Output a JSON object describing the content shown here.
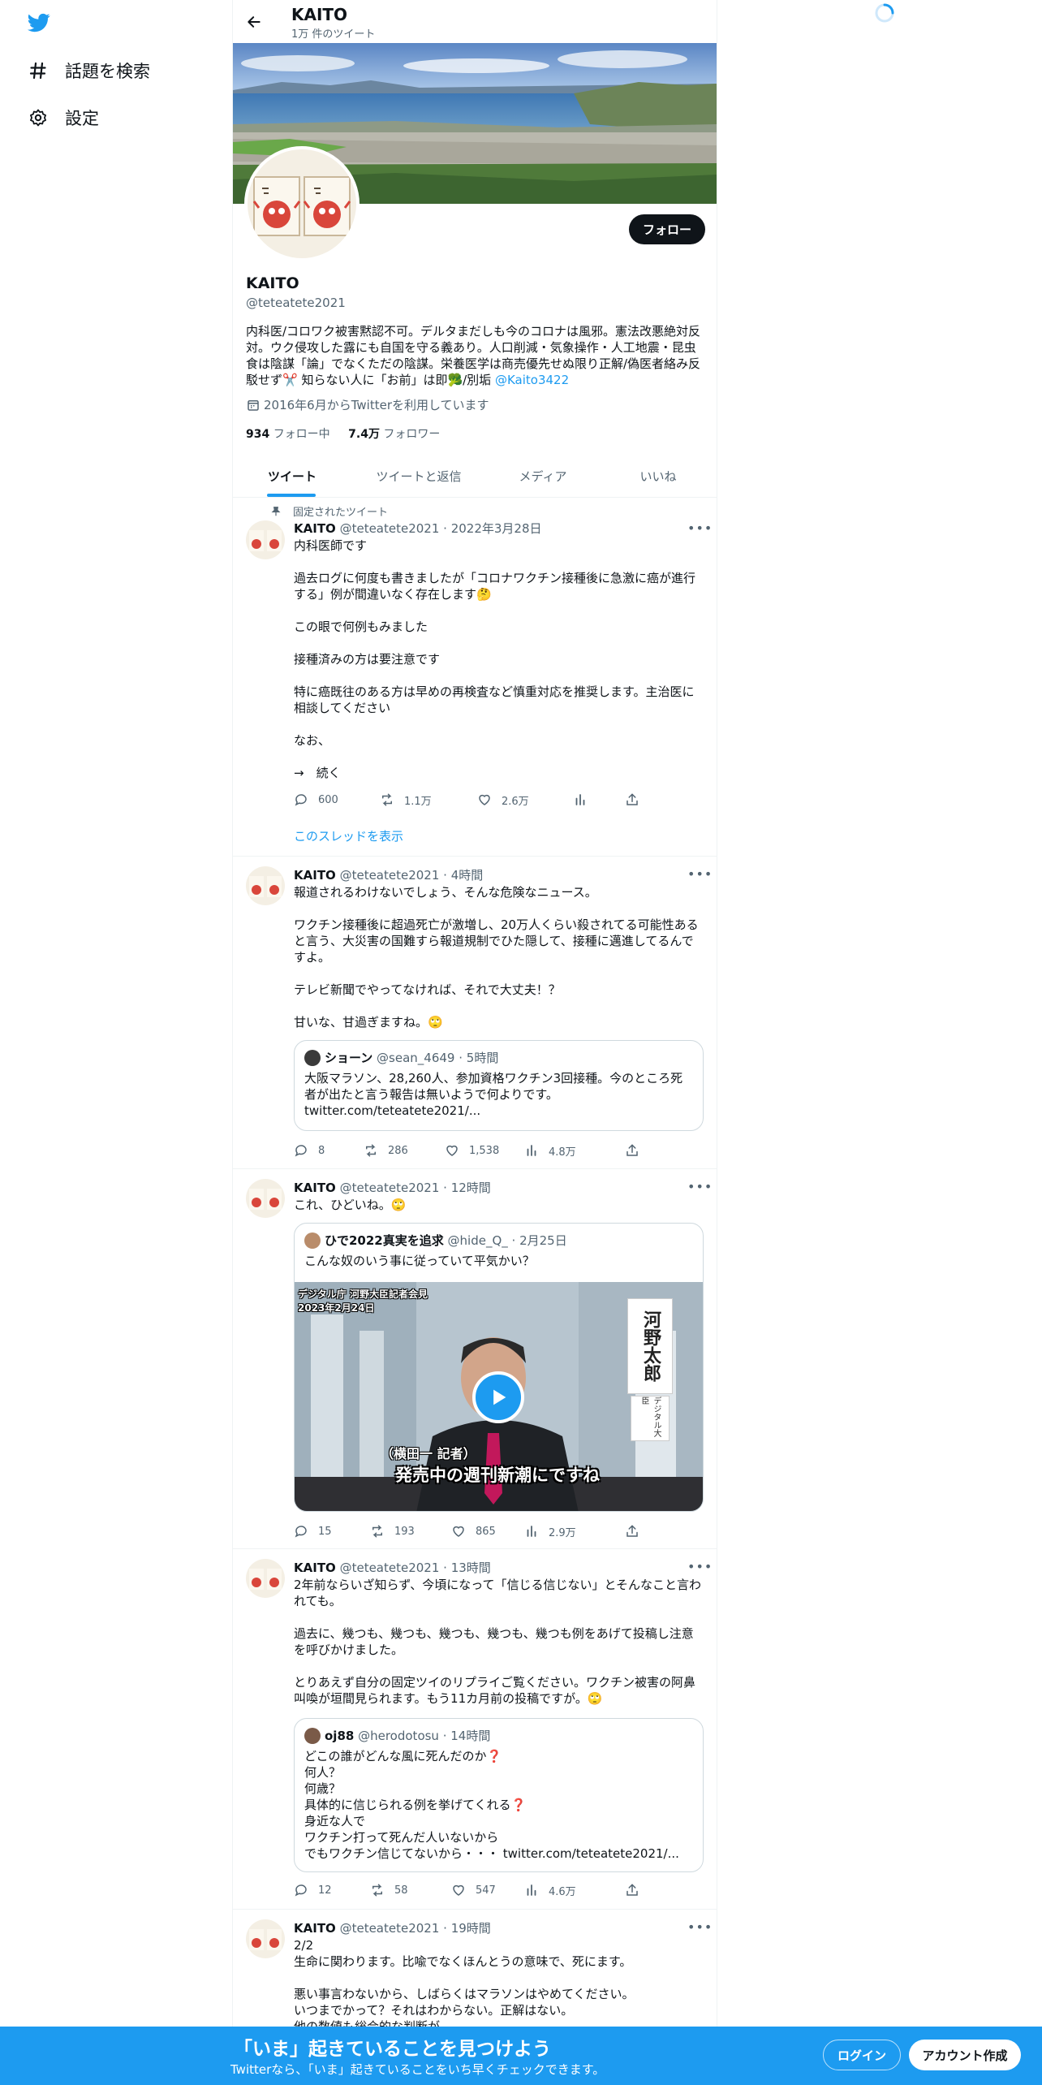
{
  "sidebar": {
    "items": [
      {
        "label": "話題を検索",
        "icon": "hashtag-icon"
      },
      {
        "label": "設定",
        "icon": "gear-icon"
      }
    ]
  },
  "header": {
    "name": "KAITO",
    "tweet_count": "1万 件のツイート"
  },
  "profile": {
    "name": "KAITO",
    "handle": "@teteatete2021",
    "follow_label": "フォロー",
    "bio": "内科医/コロワク被害黙認不可。デルタまだしも今のコロナは風邪。憲法改悪絶対反対。ウク侵攻した露にも自国を守る義あり。人口削減・気象操作・人工地震・昆虫食は陰謀「論」でなくただの陰謀。栄養医学は商売優先せぬ限り正解/偽医者絡み反駁せず✂️ 知らない人に「お前」は即🥦/別垢",
    "bio_link": "@Kaito3422",
    "joined": "2016年6月からTwitterを利用しています",
    "following_count": "934",
    "following_label": "フォロー中",
    "followers_count": "7.4万",
    "followers_label": "フォロワー"
  },
  "tabs": [
    {
      "label": "ツイート",
      "active": true
    },
    {
      "label": "ツイートと返信",
      "active": false
    },
    {
      "label": "メディア",
      "active": false
    },
    {
      "label": "いいね",
      "active": false
    }
  ],
  "tweets": [
    {
      "pinned_label": "固定されたツイート",
      "name": "KAITO",
      "handle": "@teteatete2021",
      "time": "2022年3月28日",
      "paragraphs": [
        "内科医師です",
        "過去ログに何度も書きましたが「コロナワクチン接種後に急激に癌が進行する」例が間違いなく存在します🤔",
        "この眼で何例もみました",
        "接種済みの方は要注意です",
        "特に癌既往のある方は早めの再検査など慎重対応を推奨します。主治医に相談してください",
        "なお、",
        "→　続く"
      ],
      "replies": "600",
      "retweets": "1.1万",
      "likes": "2.6万",
      "views": "",
      "thread_link": "このスレッドを表示"
    },
    {
      "name": "KAITO",
      "handle": "@teteatete2021",
      "time": "4時間",
      "paragraphs": [
        "報道されるわけないでしょう、そんな危険なニュース。",
        "ワクチン接種後に超過死亡が激増し、20万人くらい殺されてる可能性あると言う、大災害の国難すら報道規制でひた隠して、接種に邁進してるんですよ。",
        "テレビ新聞でやってなければ、それで大丈夫！？",
        "甘いな、甘過ぎますね。🙄"
      ],
      "quote": {
        "name": "ショーン",
        "handle": "@sean_4649",
        "time": "5時間",
        "text": "大阪マラソン、28,260人、参加資格ワクチン3回接種。今のところ死者が出たと言う報告は無いようで何よりです。",
        "link": "twitter.com/teteatete2021/..."
      },
      "replies": "8",
      "retweets": "286",
      "likes": "1,538",
      "views": "4.8万"
    },
    {
      "name": "KAITO",
      "handle": "@teteatete2021",
      "time": "12時間",
      "paragraphs": [
        "これ、ひどいね。🙄"
      ],
      "quote": {
        "name": "ひで2022真実を追求",
        "handle": "@hide_Q_",
        "time": "2月25日",
        "text": "こんな奴のいう事に従っていて平気かい？",
        "video_caption_top": "デジタル庁 河野大臣記者会見\n2023年2月24日",
        "video_caption_mid": "（横田一 記者）",
        "video_caption_main": "発売中の週刊新潮にですね",
        "video_side": "河野太郎",
        "video_side_small": "デジタル大臣"
      },
      "replies": "15",
      "retweets": "193",
      "likes": "865",
      "views": "2.9万"
    },
    {
      "name": "KAITO",
      "handle": "@teteatete2021",
      "time": "13時間",
      "paragraphs": [
        "2年前ならいざ知らず、今頃になって「信じる信じない」とそんなこと言われても。",
        "過去に、幾つも、幾つも、幾つも、幾つも、幾つも例をあげて投稿し注意を呼びかけました。",
        "とりあえず自分の固定ツイのリプライご覧ください。ワクチン被害の阿鼻叫喚が垣間見られます。もう11カ月前の投稿ですが。🙄"
      ],
      "quote": {
        "name": "oj88",
        "handle": "@herodotosu",
        "time": "14時間",
        "lines": [
          "どこの誰がどんな風に死んだのか❓",
          "何人？",
          "何歳？",
          "具体的に信じられる例を挙げてくれる❓",
          "身近な人で",
          "ワクチン打って死んだ人いないから",
          "でもワクチン信じてないから・・・ twitter.com/teteatete2021/..."
        ]
      },
      "replies": "12",
      "retweets": "58",
      "likes": "547",
      "views": "4.6万"
    },
    {
      "name": "KAITO",
      "handle": "@teteatete2021",
      "time": "19時間",
      "lines": [
        "2/2",
        "生命に関わります。比喩でなくほんとうの意味で、死にます。",
        "",
        "悪い事言わないから、しばらくはマラソンはやめてください。",
        "いつまでかって？それはわからない。正解はない。",
        "他の数値も総合的な判断が..."
      ]
    }
  ],
  "bottom_bar": {
    "title": "「いま」起きていることを見つけよう",
    "subtitle": "Twitterなら、「いま」起きていることをいち早くチェックできます。",
    "login_label": "ログイン",
    "signup_label": "アカウント作成"
  },
  "colors": {
    "accent": "#1d9bf0",
    "text": "#0f1419",
    "muted": "#536471",
    "border": "#eff3f4"
  }
}
